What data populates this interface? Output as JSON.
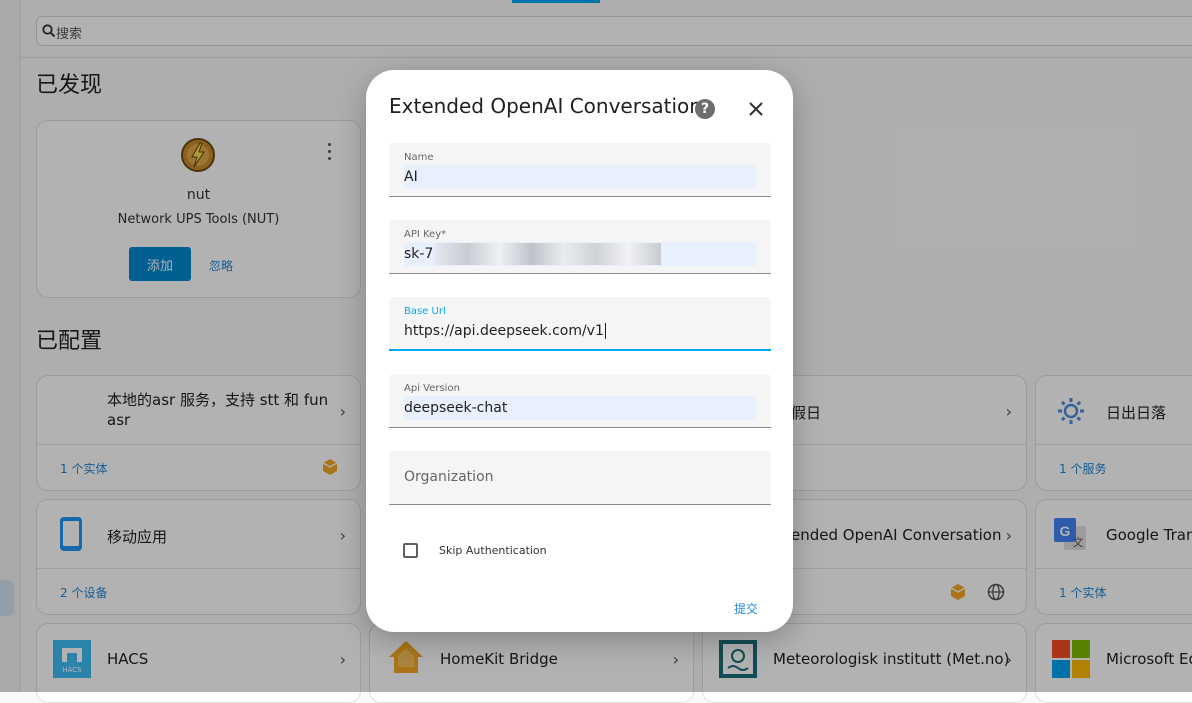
{
  "search": {
    "placeholder": "搜索"
  },
  "discovered": {
    "title": "已发现",
    "card": {
      "name": "nut",
      "subtitle": "Network UPS Tools (NUT)",
      "add_label": "添加",
      "ignore_label": "忽略"
    }
  },
  "configured": {
    "title": "已配置",
    "cards": [
      {
        "title": "本地的asr 服务，支持 stt 和 fun asr",
        "link": "1 个实体"
      },
      {
        "title": "假日",
        "link": ""
      },
      {
        "title": "日出日落",
        "link": "1 个服务"
      },
      {
        "title": "移动应用",
        "link": "2 个设备"
      },
      {
        "title": "ended OpenAI Conversation",
        "link": ""
      },
      {
        "title": "Google Trans",
        "link": "1 个实体"
      },
      {
        "title": "HACS",
        "link": ""
      },
      {
        "title": "HomeKit Bridge",
        "link": ""
      },
      {
        "title": "Meteorologisk institutt (Met.no)",
        "link": ""
      },
      {
        "title": "Microsoft Ed",
        "link": ""
      }
    ]
  },
  "dialog": {
    "title": "Extended OpenAI Conversation",
    "fields": {
      "name": {
        "label": "Name",
        "value": "AI"
      },
      "api_key": {
        "label": "API Key*",
        "value": "sk-7"
      },
      "base_url": {
        "label": "Base Url",
        "value": "https://api.deepseek.com/v1"
      },
      "api_version": {
        "label": "Api Version",
        "value": "deepseek-chat"
      },
      "organization": {
        "placeholder": "Organization"
      }
    },
    "skip_auth_label": "Skip Authentication",
    "skip_auth_checked": false,
    "submit_label": "提交"
  },
  "colors": {
    "accent": "#03a9f4",
    "primary_button": "#0288d1",
    "link": "#1e88d8",
    "hacs": "#41bdf5",
    "homekit": "#f5a623"
  }
}
